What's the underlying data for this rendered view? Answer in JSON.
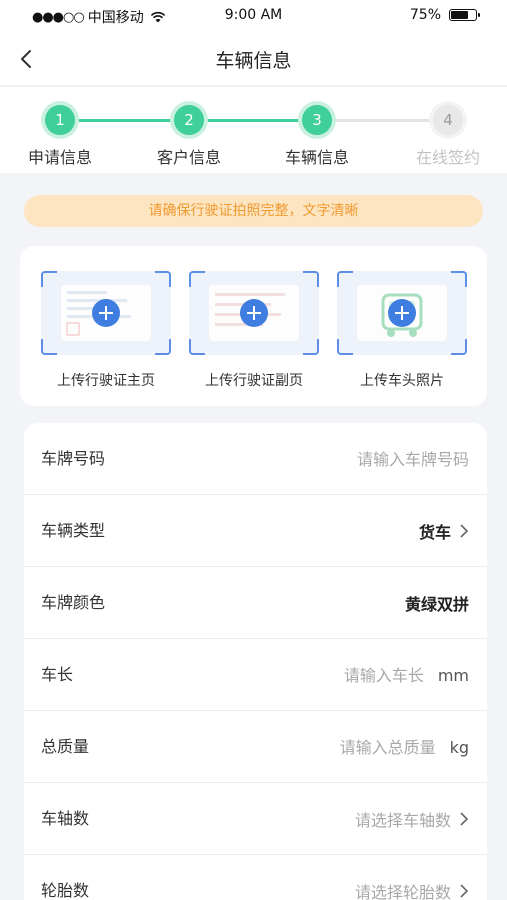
{
  "status_bar": {
    "signal": "●●●○○",
    "carrier": "中国移动",
    "time": "9:00 AM",
    "battery_pct": "75%",
    "battery_level": 0.75
  },
  "nav": {
    "title": "车辆信息"
  },
  "steps": [
    {
      "num": "1",
      "label": "申请信息",
      "state": "done"
    },
    {
      "num": "2",
      "label": "客户信息",
      "state": "done"
    },
    {
      "num": "3",
      "label": "车辆信息",
      "state": "done"
    },
    {
      "num": "4",
      "label": "在线签约",
      "state": "todo"
    }
  ],
  "notice": "请确保行驶证拍照完整，文字清晰",
  "uploads": [
    {
      "label": "上传行驶证主页",
      "icon": "license-front-icon"
    },
    {
      "label": "上传行驶证副页",
      "icon": "license-back-icon"
    },
    {
      "label": "上传车头照片",
      "icon": "truck-front-icon"
    }
  ],
  "form": {
    "plate_number": {
      "label": "车牌号码",
      "placeholder": "请输入车牌号码"
    },
    "vehicle_type": {
      "label": "车辆类型",
      "value": "货车"
    },
    "plate_color": {
      "label": "车牌颜色",
      "value": "黄绿双拼"
    },
    "length": {
      "label": "车长",
      "placeholder": "请输入车长",
      "unit": "mm"
    },
    "total_mass": {
      "label": "总质量",
      "placeholder": "请输入总质量",
      "unit": "kg"
    },
    "axle_count": {
      "label": "车轴数",
      "placeholder": "请选择车轴数"
    },
    "tire_count": {
      "label": "轮胎数",
      "placeholder": "请选择轮胎数"
    }
  },
  "colors": {
    "accent_green": "#3fcf9a",
    "accent_blue": "#3f7ee0",
    "notice_bg": "#fde5c2",
    "notice_text": "#ef9a2f"
  }
}
